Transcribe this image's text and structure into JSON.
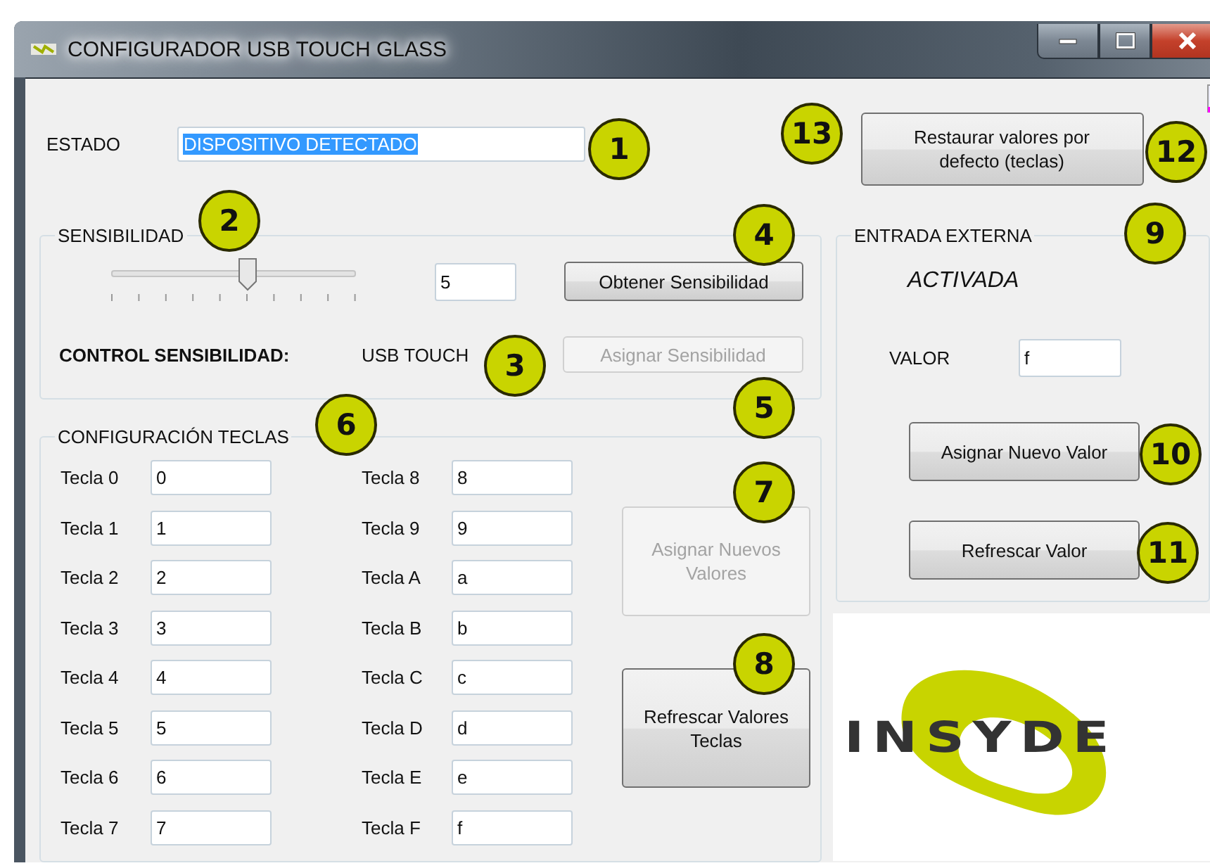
{
  "window": {
    "title": "CONFIGURADOR USB TOUCH GLASS"
  },
  "estado": {
    "label": "ESTADO",
    "value": "DISPOSITIVO DETECTADO",
    "selected": true
  },
  "restore_button": {
    "label": "Restaurar valores por defecto (teclas)"
  },
  "sensibilidad": {
    "title": "SENSIBILIDAD",
    "level": 0.556,
    "value": "5",
    "get_button": {
      "label": "Obtener Sensibilidad"
    },
    "control_label": "CONTROL SENSIBILIDAD:",
    "control_value": "USB TOUCH",
    "assign_button": {
      "label": "Asignar Sensibilidad",
      "disabled": true
    }
  },
  "teclas": {
    "title": "CONFIGURACIÓN TECLAS",
    "keys": [
      {
        "label": "Tecla 0",
        "value": "0"
      },
      {
        "label": "Tecla 1",
        "value": "1"
      },
      {
        "label": "Tecla 2",
        "value": "2"
      },
      {
        "label": "Tecla 3",
        "value": "3"
      },
      {
        "label": "Tecla 4",
        "value": "4"
      },
      {
        "label": "Tecla 5",
        "value": "5"
      },
      {
        "label": "Tecla 6",
        "value": "6"
      },
      {
        "label": "Tecla 7",
        "value": "7"
      },
      {
        "label": "Tecla 8",
        "value": "8"
      },
      {
        "label": "Tecla 9",
        "value": "9"
      },
      {
        "label": "Tecla A",
        "value": "a"
      },
      {
        "label": "Tecla B",
        "value": "b"
      },
      {
        "label": "Tecla C",
        "value": "c"
      },
      {
        "label": "Tecla D",
        "value": "d"
      },
      {
        "label": "Tecla E",
        "value": "e"
      },
      {
        "label": "Tecla F",
        "value": "f"
      }
    ],
    "assign_button": {
      "label": "Asignar Nuevos Valores",
      "disabled": true
    },
    "refresh_button": {
      "label": "Refrescar Valores Teclas",
      "disabled": false
    }
  },
  "entrada_externa": {
    "title": "ENTRADA EXTERNA",
    "status": "ACTIVADA",
    "value_label": "VALOR",
    "value": "f",
    "assign_button": {
      "label": "Asignar Nuevo Valor",
      "disabled": false
    },
    "refresh_button": {
      "label": "Refrescar Valor",
      "disabled": false
    }
  },
  "logo": {
    "text": "INSYDE"
  },
  "callouts": [
    "13",
    "1",
    "12",
    "2",
    "4",
    "9",
    "3",
    "5",
    "6",
    "10",
    "7",
    "11",
    "8"
  ]
}
